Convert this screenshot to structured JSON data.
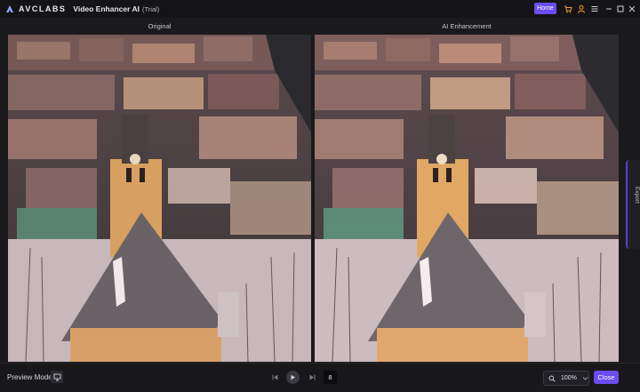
{
  "titlebar": {
    "brand": "AVCLABS",
    "app_title": "Video Enhancer AI",
    "app_suffix": "(Trial)",
    "home_label": "Home",
    "icons": [
      "cart-icon",
      "user-icon",
      "menu-icon",
      "minimize-icon",
      "maximize-icon",
      "close-icon"
    ]
  },
  "compare": {
    "left_label": "Original",
    "right_label": "AI Enhancement"
  },
  "side_panel": {
    "label": "Export"
  },
  "bottombar": {
    "preview_label": "Preview Mode",
    "frame_value": "8",
    "zoom_value": "100%",
    "close_label": "Close"
  },
  "colors": {
    "accent": "#6a4cf0",
    "background": "#1a1a1c",
    "titlebar": "#141416"
  }
}
